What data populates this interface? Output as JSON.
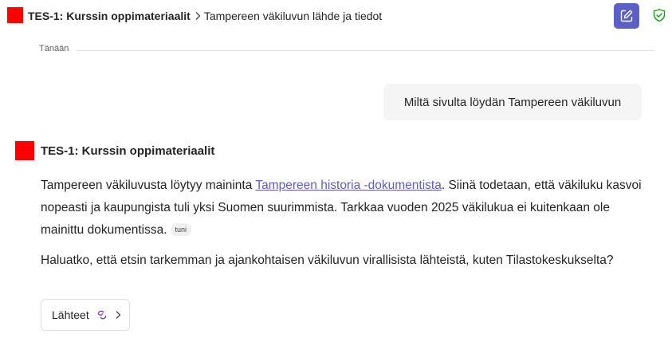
{
  "header": {
    "bot_name": "TES-1: Kurssin oppimateriaalit",
    "separator": ">",
    "conversation_title": "Tampereen väkiluvun lähde ja tiedot",
    "compose_icon": "compose-icon",
    "shield_icon": "shield-check-icon",
    "accent_color": "#5b5fc7",
    "shield_color": "#13a10e"
  },
  "divider": {
    "label": "Tänään"
  },
  "user_message": {
    "text": "Miltä sivulta löydän Tampereen väkiluvun"
  },
  "bot_message": {
    "name": "TES-1: Kurssin oppimateriaalit",
    "avatar_color": "#ff0000",
    "p1_before_link": "Tampereen väkiluvusta löytyy maininta ",
    "link_text": "Tampereen historia -dokumentista",
    "p1_after_link": ". Siinä todetaan, että väkiluku kasvoi nopeasti ja kaupungista tuli yksi Suomen suurimmista. Tarkkaa vuoden 2025 väkilukua ei kuitenkaan ole mainittu dokumentissa.",
    "citation": "tuni",
    "p2": "Haluatko, että etsin tarkemman ja ajankohtaisen väkiluvun virallisista lähteistä, kuten Tilastokeskukselta?",
    "sources_button": "Lähteet",
    "sources_icon": "sources-swirl-icon",
    "chevron_icon": "chevron-right-icon"
  }
}
